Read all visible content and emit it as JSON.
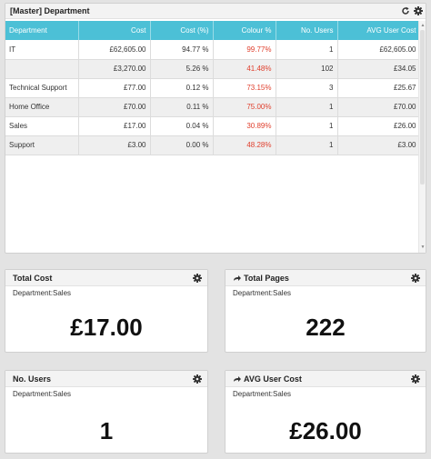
{
  "main": {
    "title": "[Master] Department",
    "columns": [
      "Department",
      "Cost",
      "Cost (%)",
      "Colour %",
      "No. Users",
      "AVG User Cost"
    ],
    "rows": [
      [
        "IT",
        "£62,605.00",
        "94.77 %",
        "99.77%",
        "1",
        "£62,605.00"
      ],
      [
        "",
        "£3,270.00",
        "5.26 %",
        "41.48%",
        "102",
        "£34.05"
      ],
      [
        "Technical Support",
        "£77.00",
        "0.12 %",
        "73.15%",
        "3",
        "£25.67"
      ],
      [
        "Home Office",
        "£70.00",
        "0.11 %",
        "75.00%",
        "1",
        "£70.00"
      ],
      [
        "Sales",
        "£17.00",
        "0.04 %",
        "30.89%",
        "1",
        "£26.00"
      ],
      [
        "Support",
        "£3.00",
        "0.00 %",
        "48.28%",
        "1",
        "£3.00"
      ]
    ]
  },
  "kpis": {
    "total_cost": {
      "title": "Total Cost",
      "subtitle": "Department:Sales",
      "value": "£17.00"
    },
    "total_pages": {
      "title": "Total Pages",
      "subtitle": "Department:Sales",
      "value": "222"
    },
    "users": {
      "title": "No. Users",
      "subtitle": "Department:Sales",
      "value": "1"
    },
    "avg_user_cost": {
      "title": "AVG User Cost",
      "subtitle": "Department:Sales",
      "value": "£26.00"
    }
  },
  "icons": {
    "refresh": "refresh-icon",
    "gear": "gear-icon",
    "arrow": "share-arrow-icon",
    "scroll_up": "scroll-up-arrow-icon",
    "scroll_down": "scroll-down-arrow-icon"
  },
  "colors": {
    "header_accent": "#4cc0d6",
    "negative_text": "#e0412f",
    "alt_row": "#efefef",
    "background": "#e3e3e3"
  }
}
